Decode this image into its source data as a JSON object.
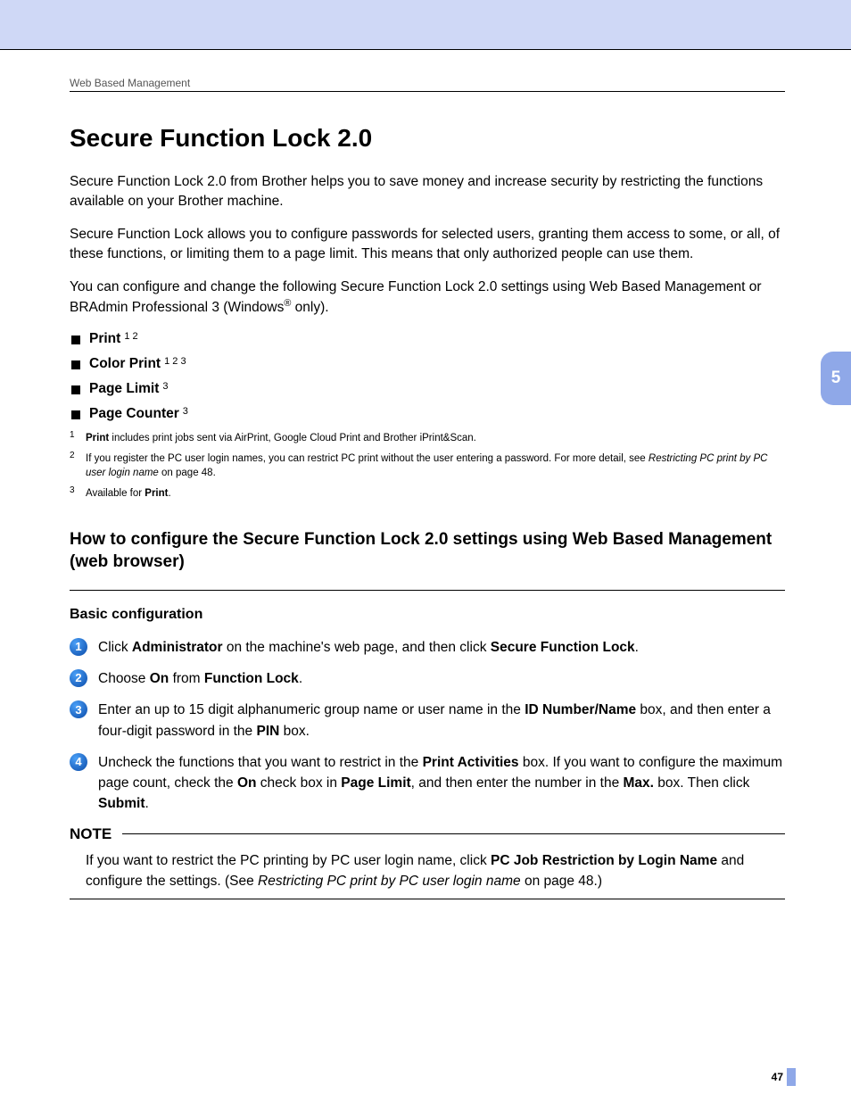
{
  "running_head": "Web Based Management",
  "title": "Secure Function Lock 2.0",
  "para1": "Secure Function Lock 2.0 from Brother helps you to save money and increase security by restricting the functions available on your Brother machine.",
  "para2": "Secure Function Lock allows you to configure passwords for selected users, granting them access to some, or all, of these functions, or limiting them to a page limit. This means that only authorized people can use them.",
  "para3_a": "You can configure and change the following Secure Function Lock 2.0 settings using Web Based Management or BRAdmin Professional 3 (Windows",
  "para3_sup": "®",
  "para3_b": " only).",
  "bullets": [
    {
      "label": "Print",
      "refs": "1 2"
    },
    {
      "label": "Color Print",
      "refs": "1 2 3"
    },
    {
      "label": "Page Limit",
      "refs": "3"
    },
    {
      "label": "Page Counter",
      "refs": "3"
    }
  ],
  "footnotes": {
    "f1": {
      "num": "1",
      "b": "Print",
      "rest": " includes print jobs sent via AirPrint, Google Cloud Print and Brother iPrint&Scan."
    },
    "f2": {
      "num": "2",
      "a": "If you register the PC user login names, you can restrict PC print without the user entering a password. For more detail, see ",
      "i": "Restricting PC print by PC user login name",
      "b": " on page 48."
    },
    "f3": {
      "num": "3",
      "a": "Available for ",
      "b": "Print",
      "c": "."
    }
  },
  "subhead": "How to configure the Secure Function Lock 2.0 settings using Web Based Management (web browser)",
  "h3": "Basic configuration",
  "steps": {
    "s1": {
      "n": "1",
      "a": "Click ",
      "b1": "Administrator",
      "c": " on the machine's web page, and then click ",
      "b2": "Secure Function Lock",
      "d": "."
    },
    "s2": {
      "n": "2",
      "a": "Choose ",
      "b1": "On",
      "c": " from ",
      "b2": "Function Lock",
      "d": "."
    },
    "s3": {
      "n": "3",
      "a": "Enter an up to 15 digit alphanumeric group name or user name in the ",
      "b1": "ID Number/Name",
      "c": " box, and then enter a four-digit password in the ",
      "b2": "PIN",
      "d": " box."
    },
    "s4": {
      "n": "4",
      "a": "Uncheck the functions that you want to restrict in the ",
      "b1": "Print Activities",
      "c": " box. If you want to configure the maximum page count, check the ",
      "b2": "On",
      "d": " check box in ",
      "b3": "Page Limit",
      "e": ", and then enter the number in the ",
      "b4": "Max.",
      "f": " box. Then click ",
      "b5": "Submit",
      "g": "."
    }
  },
  "note_label": "NOTE",
  "note": {
    "a": "If you want to restrict the PC printing by PC user login name, click ",
    "b": "PC Job Restriction by Login Name",
    "c": " and configure the settings. (See ",
    "i": "Restricting PC print by PC user login name",
    "d": " on page 48.)"
  },
  "chapter_tab": "5",
  "page_number": "47"
}
